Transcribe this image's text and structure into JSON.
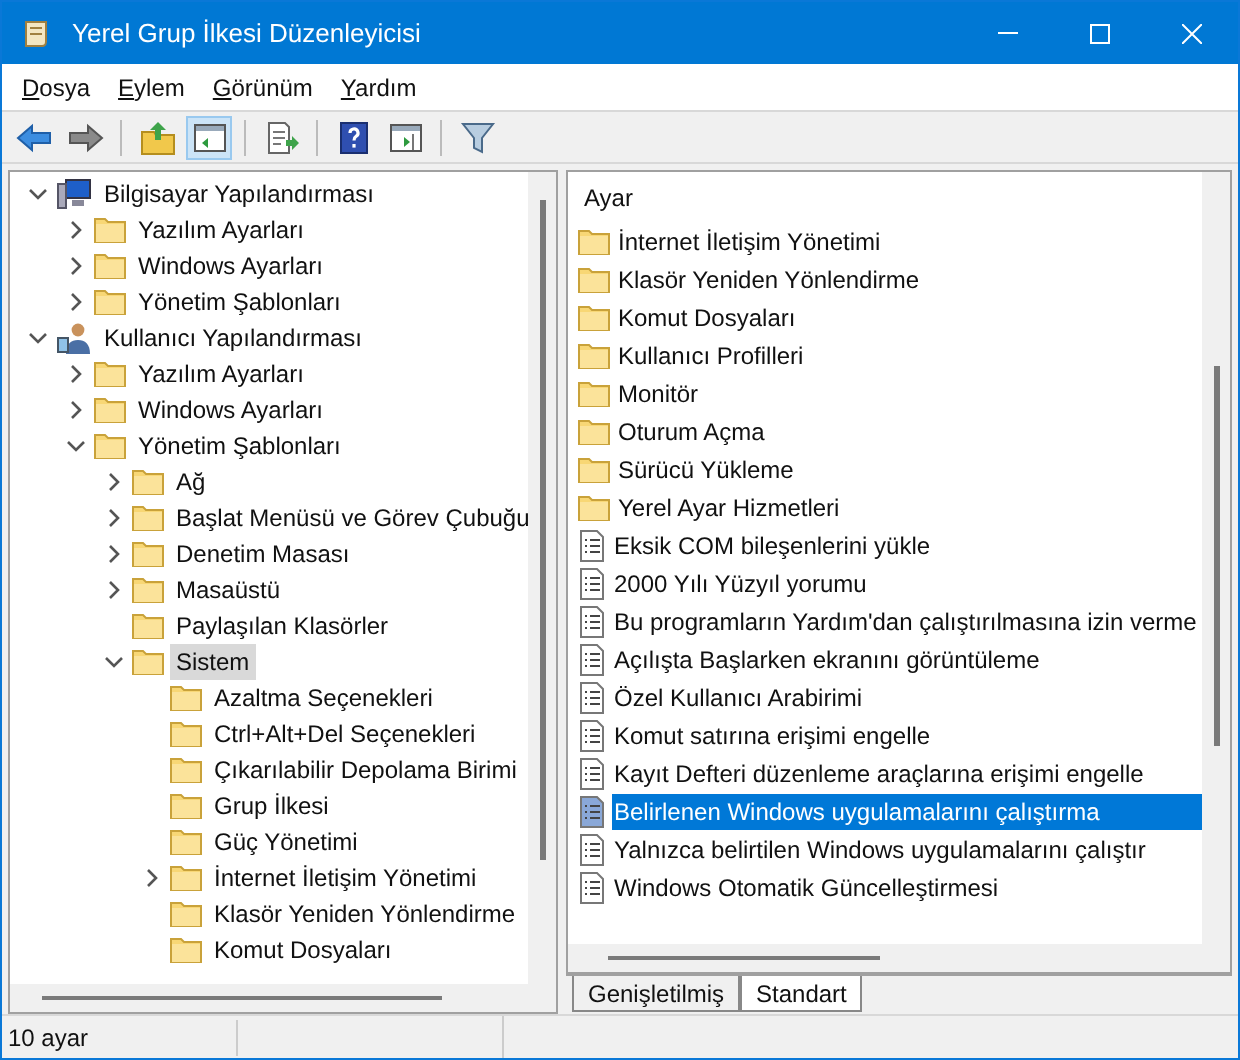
{
  "window": {
    "title": "Yerel Grup İlkesi Düzenleyicisi"
  },
  "menu": [
    "Dosya",
    "Eylem",
    "Görünüm",
    "Yardım"
  ],
  "toolbar": [
    {
      "kind": "back",
      "pressed": false
    },
    {
      "kind": "forward",
      "pressed": false
    },
    {
      "kind": "sep"
    },
    {
      "kind": "up",
      "pressed": false
    },
    {
      "kind": "tree",
      "pressed": true
    },
    {
      "kind": "sep"
    },
    {
      "kind": "export",
      "pressed": false
    },
    {
      "kind": "sep"
    },
    {
      "kind": "help",
      "pressed": false
    },
    {
      "kind": "pane",
      "pressed": false
    },
    {
      "kind": "sep"
    },
    {
      "kind": "filter",
      "pressed": false
    }
  ],
  "tree": [
    {
      "label": "Bilgisayar Yapılandırması",
      "kind": "computer",
      "expanded": true,
      "selected": false,
      "children": [
        {
          "label": "Yazılım Ayarları",
          "kind": "folder",
          "expanded": false,
          "selected": false
        },
        {
          "label": "Windows Ayarları",
          "kind": "folder",
          "expanded": false,
          "selected": false
        },
        {
          "label": "Yönetim Şablonları",
          "kind": "folder",
          "expanded": false,
          "selected": false
        }
      ]
    },
    {
      "label": "Kullanıcı Yapılandırması",
      "kind": "user",
      "expanded": true,
      "selected": false,
      "children": [
        {
          "label": "Yazılım Ayarları",
          "kind": "folder",
          "expanded": false,
          "selected": false
        },
        {
          "label": "Windows Ayarları",
          "kind": "folder",
          "expanded": false,
          "selected": false
        },
        {
          "label": "Yönetim Şablonları",
          "kind": "folder",
          "expanded": true,
          "selected": false,
          "children": [
            {
              "label": "Ağ",
              "kind": "folder",
              "expanded": false,
              "selected": false
            },
            {
              "label": "Başlat Menüsü ve Görev Çubuğu",
              "kind": "folder",
              "expanded": false,
              "selected": false
            },
            {
              "label": "Denetim Masası",
              "kind": "folder",
              "expanded": false,
              "selected": false
            },
            {
              "label": "Masaüstü",
              "kind": "folder",
              "expanded": false,
              "selected": false
            },
            {
              "label": "Paylaşılan Klasörler",
              "kind": "folder",
              "selected": false
            },
            {
              "label": "Sistem",
              "kind": "folder",
              "expanded": true,
              "selected": true,
              "children": [
                {
                  "label": "Azaltma Seçenekleri",
                  "kind": "folder",
                  "selected": false
                },
                {
                  "label": "Ctrl+Alt+Del Seçenekleri",
                  "kind": "folder",
                  "selected": false
                },
                {
                  "label": "Çıkarılabilir Depolama Birimi",
                  "kind": "folder",
                  "selected": false
                },
                {
                  "label": "Grup İlkesi",
                  "kind": "folder",
                  "selected": false
                },
                {
                  "label": "Güç Yönetimi",
                  "kind": "folder",
                  "selected": false
                },
                {
                  "label": "İnternet İletişim Yönetimi",
                  "kind": "folder",
                  "expanded": false,
                  "selected": false
                },
                {
                  "label": "Klasör Yeniden Yönlendirme",
                  "kind": "folder",
                  "selected": false
                },
                {
                  "label": "Komut Dosyaları",
                  "kind": "folder",
                  "selected": false
                }
              ]
            }
          ]
        }
      ]
    }
  ],
  "list": {
    "header": "Ayar",
    "items": [
      {
        "label": "İnternet İletişim Yönetimi",
        "kind": "folder",
        "selected": false
      },
      {
        "label": "Klasör Yeniden Yönlendirme",
        "kind": "folder",
        "selected": false
      },
      {
        "label": "Komut Dosyaları",
        "kind": "folder",
        "selected": false
      },
      {
        "label": "Kullanıcı Profilleri",
        "kind": "folder",
        "selected": false
      },
      {
        "label": "Monitör",
        "kind": "folder",
        "selected": false
      },
      {
        "label": "Oturum Açma",
        "kind": "folder",
        "selected": false
      },
      {
        "label": "Sürücü Yükleme",
        "kind": "folder",
        "selected": false
      },
      {
        "label": "Yerel Ayar Hizmetleri",
        "kind": "folder",
        "selected": false
      },
      {
        "label": "Eksik COM bileşenlerini yükle",
        "kind": "setting",
        "selected": false
      },
      {
        "label": "2000 Yılı Yüzyıl yorumu",
        "kind": "setting",
        "selected": false
      },
      {
        "label": "Bu programların Yardım'dan çalıştırılmasına izin verme",
        "kind": "setting",
        "selected": false
      },
      {
        "label": "Açılışta Başlarken ekranını görüntüleme",
        "kind": "setting",
        "selected": false
      },
      {
        "label": "Özel Kullanıcı Arabirimi",
        "kind": "setting",
        "selected": false
      },
      {
        "label": "Komut satırına erişimi engelle",
        "kind": "setting",
        "selected": false
      },
      {
        "label": "Kayıt Defteri düzenleme araçlarına erişimi engelle",
        "kind": "setting",
        "selected": false
      },
      {
        "label": "Belirlenen Windows uygulamalarını çalıştırma",
        "kind": "setting",
        "selected": true
      },
      {
        "label": "Yalnızca belirtilen Windows uygulamalarını çalıştır",
        "kind": "setting",
        "selected": false
      },
      {
        "label": "Windows Otomatik Güncelleştirmesi",
        "kind": "setting",
        "selected": false
      }
    ]
  },
  "tabs": [
    {
      "label": "Genişletilmiş",
      "selected": false
    },
    {
      "label": "Standart",
      "selected": true
    }
  ],
  "status_bar": "10 ayar"
}
